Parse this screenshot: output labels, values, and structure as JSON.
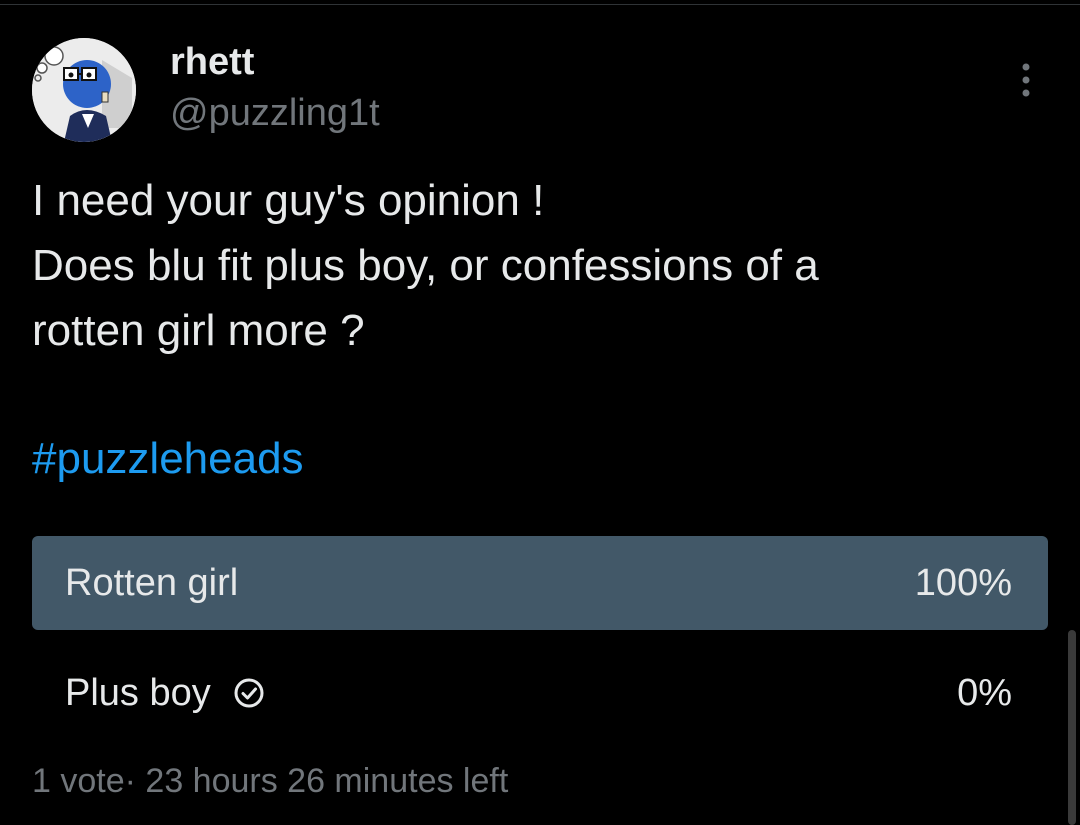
{
  "author": {
    "display_name": "rhett",
    "handle": "@puzzling1t",
    "avatar_icon": "avatar-image"
  },
  "more_icon": "more-vertical-icon",
  "tweet": {
    "lines": [
      "I need your guy's opinion !",
      "Does blu fit plus boy, or confessions of a",
      "rotten girl more ?"
    ],
    "hashtag": "#puzzleheads"
  },
  "poll": {
    "options": [
      {
        "label": "Rotten girl",
        "percent_text": "100%",
        "percent": 100,
        "selected": false
      },
      {
        "label": "Plus boy",
        "percent_text": "0%",
        "percent": 0,
        "selected": true
      }
    ],
    "votes_text": "1 vote",
    "separator": "·",
    "time_left": "23 hours 26 minutes left"
  },
  "colors": {
    "background": "#000000",
    "text_primary": "#e7e9ea",
    "text_secondary": "#71767b",
    "link": "#1d9bf0",
    "poll_bar": "#425868"
  }
}
